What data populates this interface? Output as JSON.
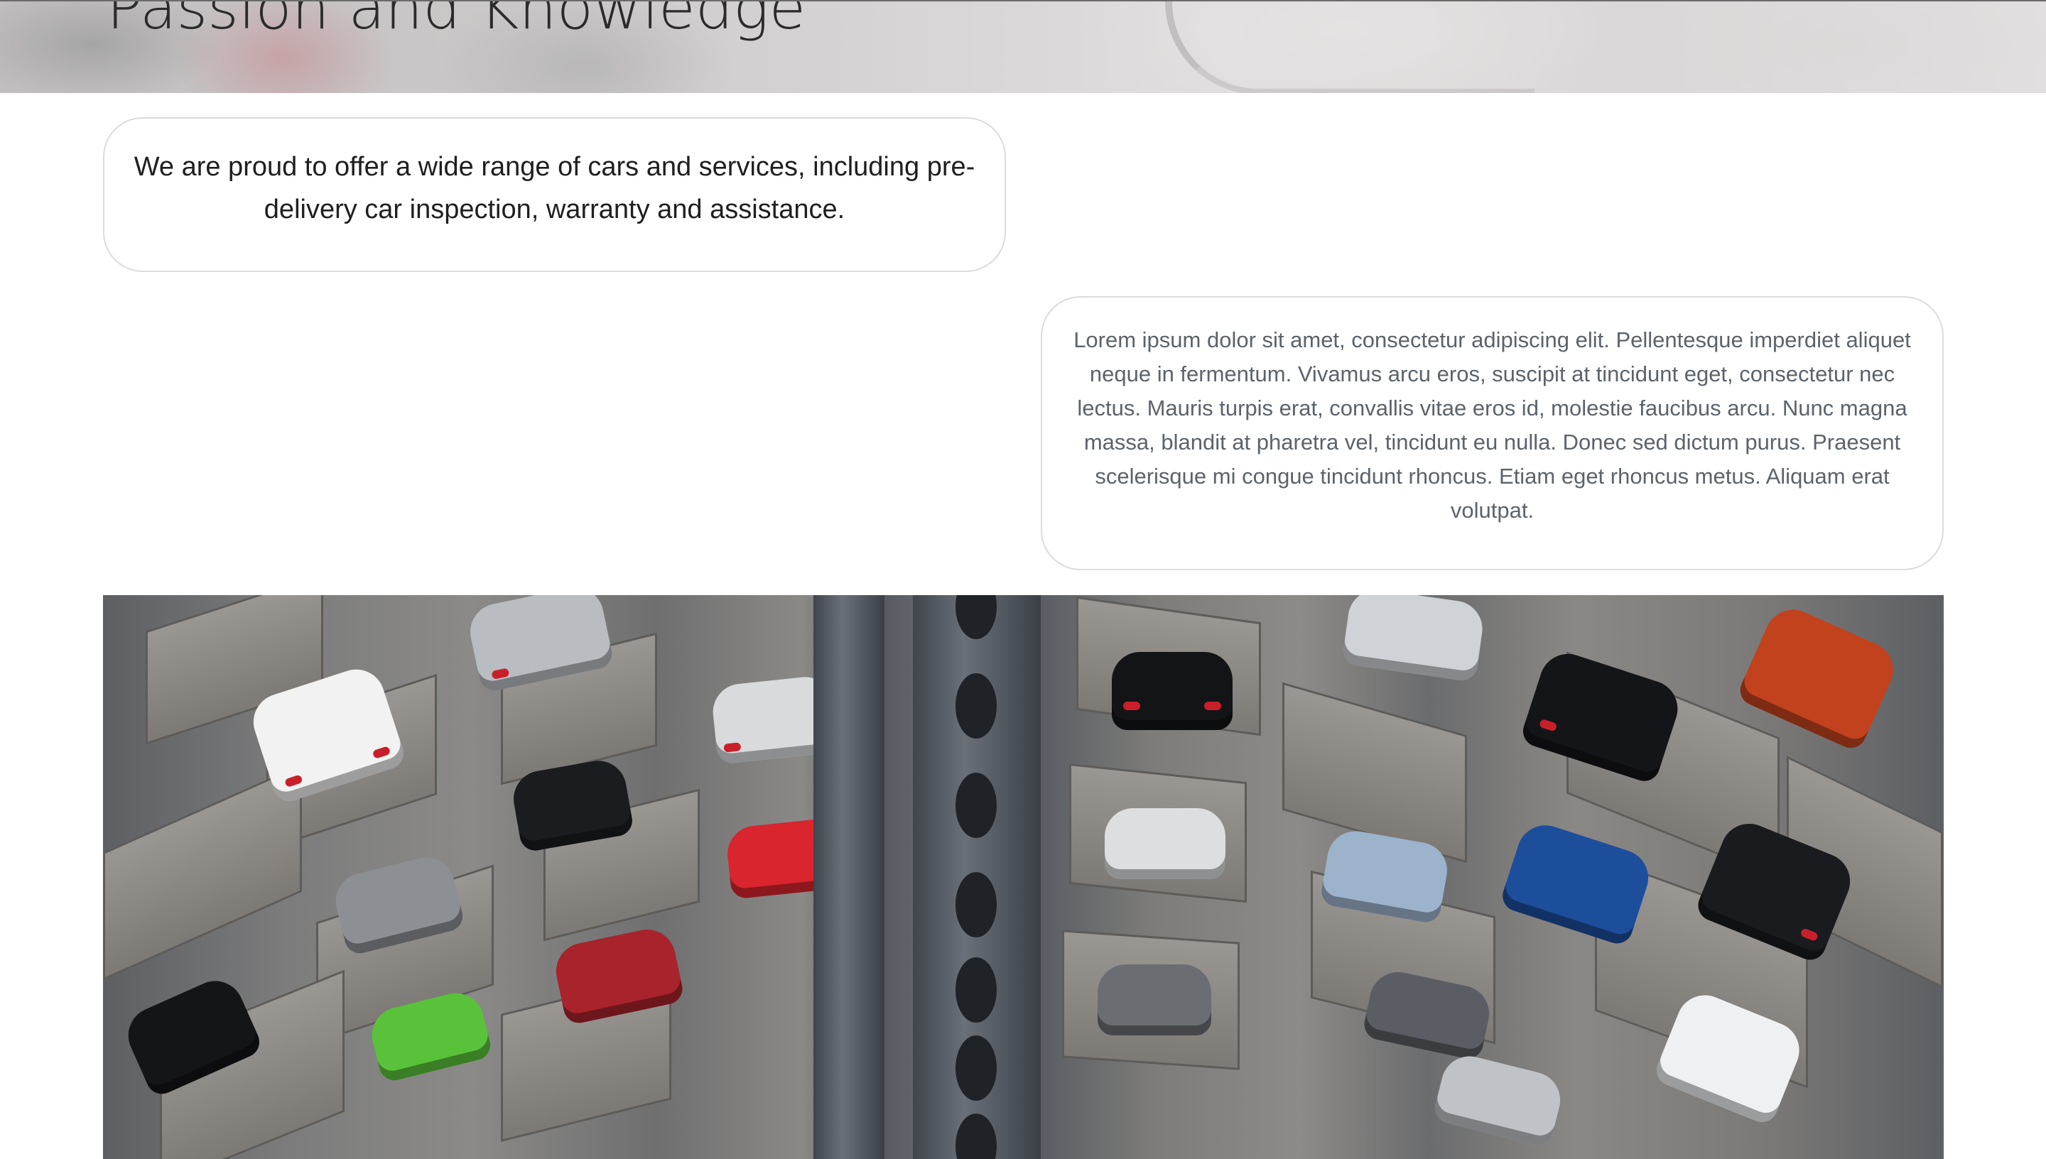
{
  "hero": {
    "title": "Passion and Knowledge"
  },
  "offer_card": {
    "text": "We are proud to offer a wide range of cars and services, including pre-delivery car inspection, warranty and assistance."
  },
  "lorem_card": {
    "text": "Lorem ipsum dolor sit amet, consectetur adipiscing elit. Pellentesque imperdiet aliquet neque in fermentum. Vivamus arcu eros, suscipit at tincidunt eget, consectetur nec lectus. Mauris turpis erat, convallis vitae eros id, molestie faucibus arcu. Nunc magna massa, blandit at pharetra vel, tincidunt eu nulla. Donec sed dictum purus. Praesent scelerisque mi congue tincidunt rhoncus. Etiam eget rhoncus metus. Aliquam erat volutpat."
  },
  "colors": {
    "card_border": "#dcdcdc",
    "offer_text": "#1f1f1f",
    "lorem_text": "#5b636b"
  }
}
